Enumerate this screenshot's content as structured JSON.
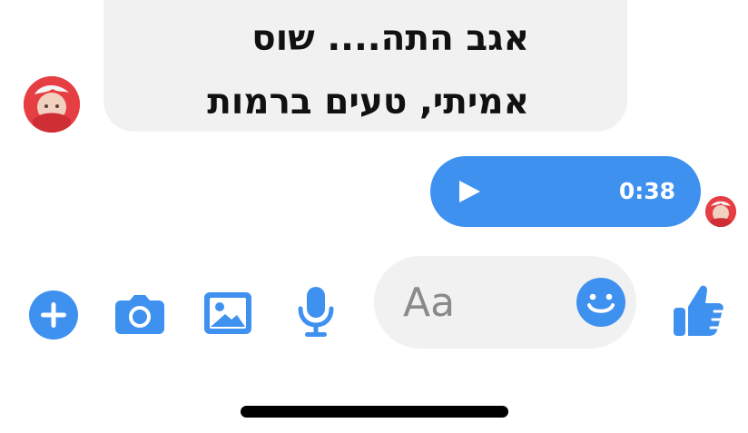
{
  "conversation": {
    "incoming_message": {
      "lines": [
        "אגב התה.... שוס",
        "אמיתי, טעים ברמות"
      ]
    },
    "outgoing_audio": {
      "duration": "0:38"
    }
  },
  "composer": {
    "placeholder": "Aa"
  },
  "icons": {
    "add": "plus-icon",
    "camera": "camera-icon",
    "gallery": "gallery-icon",
    "microphone": "mic-icon",
    "emoji": "emoji-icon",
    "like": "thumbs-up-icon",
    "play": "play-icon"
  },
  "colors": {
    "accent": "#3f91f0",
    "incoming_bubble": "#f1f1f2",
    "home_indicator": "#000000"
  }
}
